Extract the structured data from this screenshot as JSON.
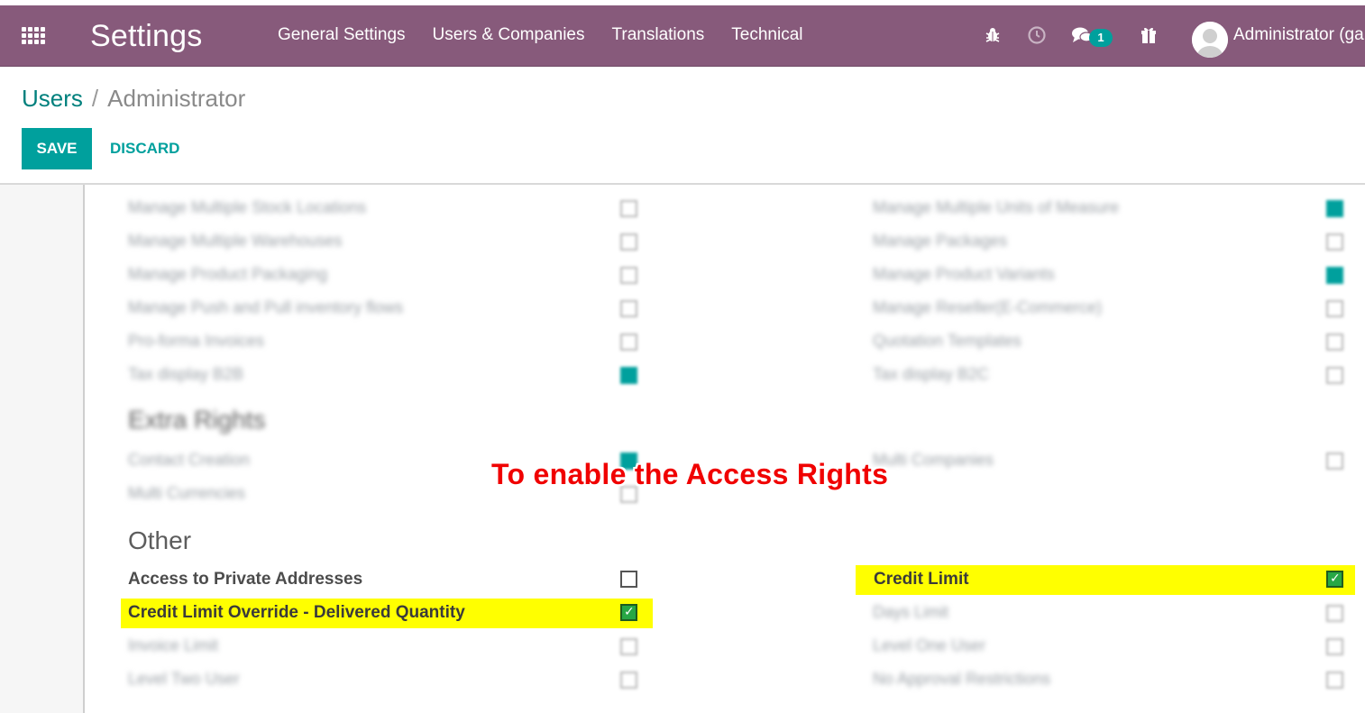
{
  "navbar": {
    "app_title": "Settings",
    "menu": [
      "General Settings",
      "Users & Companies",
      "Translations",
      "Technical"
    ],
    "message_count": "1",
    "user_name": "Administrator (ga"
  },
  "breadcrumb": {
    "parent": "Users",
    "separator": "/",
    "current": "Administrator"
  },
  "actions": {
    "save_label": "SAVE",
    "discard_label": "DISCARD"
  },
  "blurred_left": [
    {
      "label": "Manage Multiple Stock Locations",
      "checked": false
    },
    {
      "label": "Manage Multiple Warehouses",
      "checked": false
    },
    {
      "label": "Manage Product Packaging",
      "checked": false
    },
    {
      "label": "Manage Push and Pull inventory flows",
      "checked": false
    },
    {
      "label": "Pro-forma Invoices",
      "checked": false
    },
    {
      "label": "Tax display B2B",
      "checked": true
    }
  ],
  "blurred_right": [
    {
      "label": "Manage Multiple Units of Measure",
      "checked": true
    },
    {
      "label": "Manage Packages",
      "checked": false
    },
    {
      "label": "Manage Product Variants",
      "checked": true
    },
    {
      "label": "Manage Reseller(E-Commerce)",
      "checked": false
    },
    {
      "label": "Quotation Templates",
      "checked": false
    },
    {
      "label": "Tax display B2C",
      "checked": false
    }
  ],
  "extra_rights": {
    "title": "Extra Rights",
    "left": [
      {
        "label": "Contact Creation",
        "checked": true
      },
      {
        "label": "Multi Currencies",
        "checked": false
      }
    ],
    "right": [
      {
        "label": "Multi Companies",
        "checked": false
      }
    ]
  },
  "other": {
    "title": "Other",
    "access_private": "Access to Private Addresses",
    "credit_override": "Credit Limit Override - Delivered Quantity",
    "credit_limit": "Credit Limit",
    "invoice_limit": "Invoice Limit",
    "level_two": "Level Two User",
    "days_limit": "Days Limit",
    "level_one": "Level One User",
    "no_approval": "No Approval Restrictions"
  },
  "annotation": "To enable the Access Rights",
  "colors": {
    "navbar": "#875a7b",
    "primary": "#00a09d",
    "highlight": "#ffff00",
    "annotation": "#f00000"
  }
}
